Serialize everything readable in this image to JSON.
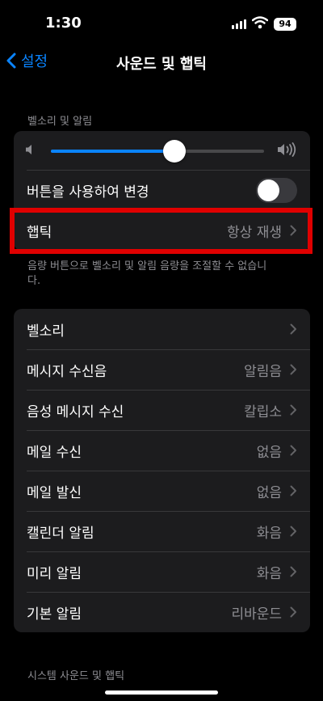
{
  "status": {
    "time": "1:30",
    "battery": "94"
  },
  "nav": {
    "back_label": "설정",
    "title": "사운드 및 햅틱"
  },
  "ringer": {
    "header": "벨소리 및 알림",
    "volume_level": 0.58,
    "change_with_buttons_label": "버튼을 사용하여 변경",
    "change_with_buttons_on": false,
    "haptics_label": "햅틱",
    "haptics_value": "항상 재생",
    "footer": "음량 버튼으로 벨소리 및 알림 음량을 조절할 수 없습니다."
  },
  "sounds": [
    {
      "label": "벨소리",
      "value": ""
    },
    {
      "label": "메시지 수신음",
      "value": "알림음"
    },
    {
      "label": "음성 메시지 수신",
      "value": "칼립소"
    },
    {
      "label": "메일 수신",
      "value": "없음"
    },
    {
      "label": "메일 발신",
      "value": "없음"
    },
    {
      "label": "캘린더 알림",
      "value": "화음"
    },
    {
      "label": "미리 알림",
      "value": "화음"
    },
    {
      "label": "기본 알림",
      "value": "리바운드"
    }
  ],
  "system": {
    "header": "시스템 사운드 및 햅틱"
  },
  "colors": {
    "accent": "#0a84ff",
    "highlight": "#e00000"
  }
}
